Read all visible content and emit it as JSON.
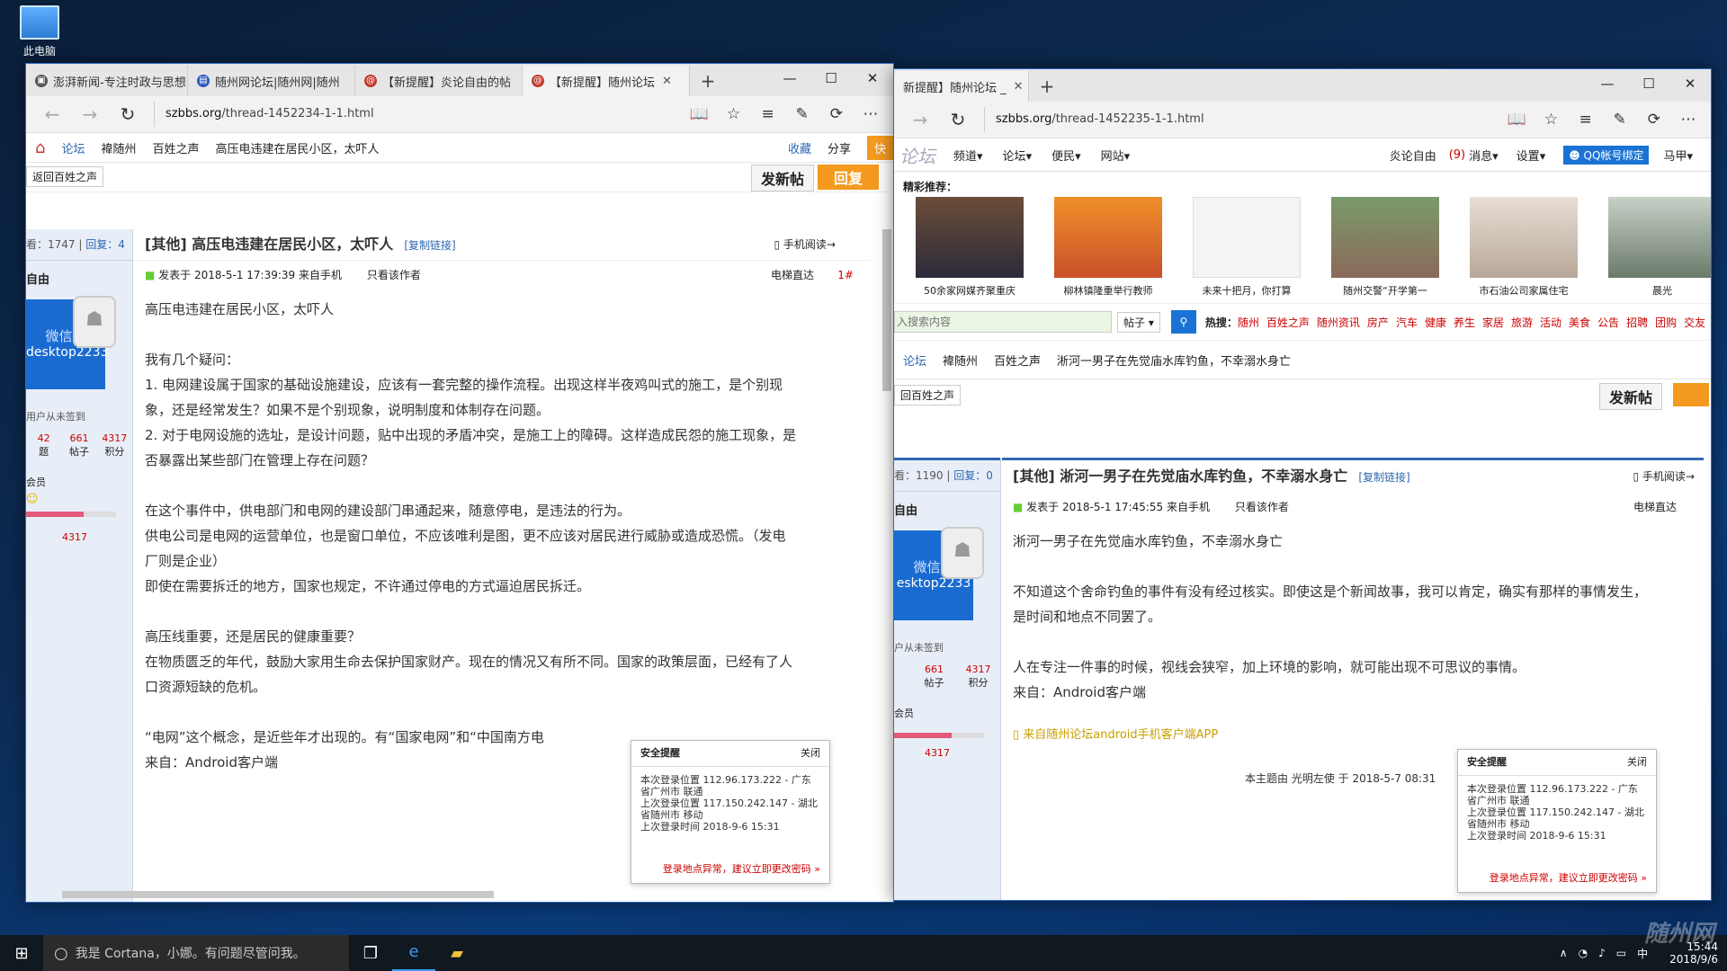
{
  "desktop": {
    "icon_label": "此电脑"
  },
  "left": {
    "tabs": [
      {
        "label": "澎湃新闻-专注时政与思想"
      },
      {
        "label": "随州网论坛|随州网|随州"
      },
      {
        "label": "【新提醒】炎论自由的帖"
      },
      {
        "label": "【新提醒】随州论坛"
      }
    ],
    "url_domain": "szbbs.org",
    "url_path": "/thread-1452234-1-1.html",
    "crumbs": [
      "论坛",
      "褘随州",
      "百姓之声",
      "高压电违建在居民小区，太吓人"
    ],
    "actions": {
      "fav": "收藏",
      "share": "分享",
      "quick": "快"
    },
    "back_label": "返回百姓之声",
    "btn_post": "发新帖",
    "btn_reply": "回复",
    "views": "看：1747",
    "replies": "回复：4",
    "title": "[其他] 高压电违建在居民小区，太吓人",
    "copy": "[复制链接]",
    "mobile": "手机阅读",
    "meta": "发表于 2018-5-1 17:39:39 来自手机",
    "author_only": "只看该作者",
    "elevator": "电梯直达",
    "floor": "1#",
    "side_user": "自由",
    "wx": "微信号",
    "wxid": "desktop2233",
    "unsigned": "用户从未签到",
    "stats": [
      {
        "n": "42",
        "l": "题"
      },
      {
        "n": "661",
        "l": "帖子"
      },
      {
        "n": "4317",
        "l": "积分"
      }
    ],
    "member": "会员",
    "points": "4317",
    "paras": [
      "高压电违建在居民小区，太吓人",
      "",
      "我有几个疑问：",
      "1. 电网建设属于国家的基础设施建设，应该有一套完整的操作流程。出现这样半夜鸡叫式的施工，是个别现",
      "象，还是经常发生？如果不是个别现象，说明制度和体制存在问题。",
      "2. 对于电网设施的选址，是设计问题，贴中出现的矛盾冲突，是施工上的障碍。这样造成民怨的施工现象，是",
      "否暴露出某些部门在管理上存在问题？",
      "",
      "在这个事件中，供电部门和电网的建设部门串通起来，随意停电，是违法的行为。",
      "供电公司是电网的运营单位，也是窗口单位，不应该唯利是图，更不应该对居民进行威胁或造成恐慌。（发电",
      "厂则是企业）",
      "即使在需要拆迁的地方，国家也规定，不许通过停电的方式逼迫居民拆迁。",
      "",
      "高压线重要，还是居民的健康重要？",
      "在物质匮乏的年代，鼓励大家用生命去保护国家财产。现在的情况又有所不同。国家的政策层面，已经有了人",
      "口资源短缺的危机。",
      "",
      "“电网”这个概念，是近些年才出现的。有“国家电网”和“中国南方电",
      "来自：Android客户端"
    ],
    "security": {
      "title": "安全提醒",
      "close": "关闭",
      "lines": [
        "本次登录位置 112.96.173.222 - 广东省广州市 联通",
        "上次登录位置 117.150.242.147 - 湖北省随州市 移动",
        "上次登录时间 2018-9-6 15:31"
      ],
      "warn": "登录地点异常，建议立即更改密码 »"
    }
  },
  "right": {
    "tab": "新提醒】随州论坛 _",
    "url_domain": "szbbs.org",
    "url_path": "/thread-1452235-1-1.html",
    "logo": "论坛",
    "menu": [
      "频道",
      "论坛",
      "便民",
      "网站"
    ],
    "user_links": {
      "name": "炎论自由",
      "msg_count": "(9)",
      "msg": "消息",
      "settings": "设置",
      "qq": "QQ帐号绑定",
      "horse": "马甲"
    },
    "picks_title": "精彩推荐：",
    "picks": [
      "50余家网媒齐聚重庆",
      "柳林镇隆重举行教师",
      "未来十把月，你打算",
      "随州交警“开学第一",
      "市石油公司家属住宅",
      "晨光"
    ],
    "search_placeholder": "入搜索内容",
    "search_type": "帖子",
    "hot_label": "热搜：",
    "hot": [
      "随州",
      "百姓之声",
      "随州资讯",
      "房产",
      "汽车",
      "健康",
      "养生",
      "家居",
      "旅游",
      "活动",
      "美食",
      "公告",
      "招聘",
      "团购",
      "交友"
    ],
    "crumbs": [
      "论坛",
      "褘随州",
      "百姓之声",
      "淅河一男子在先觉庙水库钓鱼，不幸溺水身亡"
    ],
    "back_label": "回百姓之声",
    "btn_post": "发新帖",
    "views": "看：1190",
    "replies": "回复：0",
    "title": "[其他] 淅河一男子在先觉庙水库钓鱼，不幸溺水身亡",
    "copy": "[复制链接]",
    "mobile": "手机阅读",
    "meta": "发表于 2018-5-1 17:45:55 来自手机",
    "author_only": "只看该作者",
    "elevator": "电梯直达",
    "side_user": "自由",
    "wx": "微信号",
    "wxid": "esktop2233",
    "unsigned": "户从未签到",
    "stats": [
      {
        "n": "661",
        "l": "帖子"
      },
      {
        "n": "4317",
        "l": "积分"
      }
    ],
    "member": "会员",
    "points": "4317",
    "paras": [
      "淅河一男子在先觉庙水库钓鱼，不幸溺水身亡",
      "",
      "不知道这个舍命钓鱼的事件有没有经过核实。即使这是个新闻故事，我可以肯定，确实有那样的事情发生，",
      "是时间和地点不同罢了。",
      "",
      "人在专注一件事的时候，视线会狭窄，加上环境的影响，就可能出现不可思议的事情。",
      "来自：Android客户端"
    ],
    "app_link": "来自随州论坛android手机客户端APP",
    "footer": "本主题由 光明左使 于 2018-5-7 08:31",
    "security": {
      "title": "安全提醒",
      "close": "关闭",
      "lines": [
        "本次登录位置 112.96.173.222 - 广东省广州市 联通",
        "上次登录位置 117.150.242.147 - 湖北省随州市 移动",
        "上次登录时间 2018-9-6 15:31"
      ],
      "warn": "登录地点异常，建议立即更改密码 »"
    }
  },
  "taskbar": {
    "cortana": "我是 Cortana，小娜。有问题尽管问我。",
    "ime": "中",
    "time": "15:44",
    "date": "2018/9/6",
    "watermark": "随州网"
  }
}
